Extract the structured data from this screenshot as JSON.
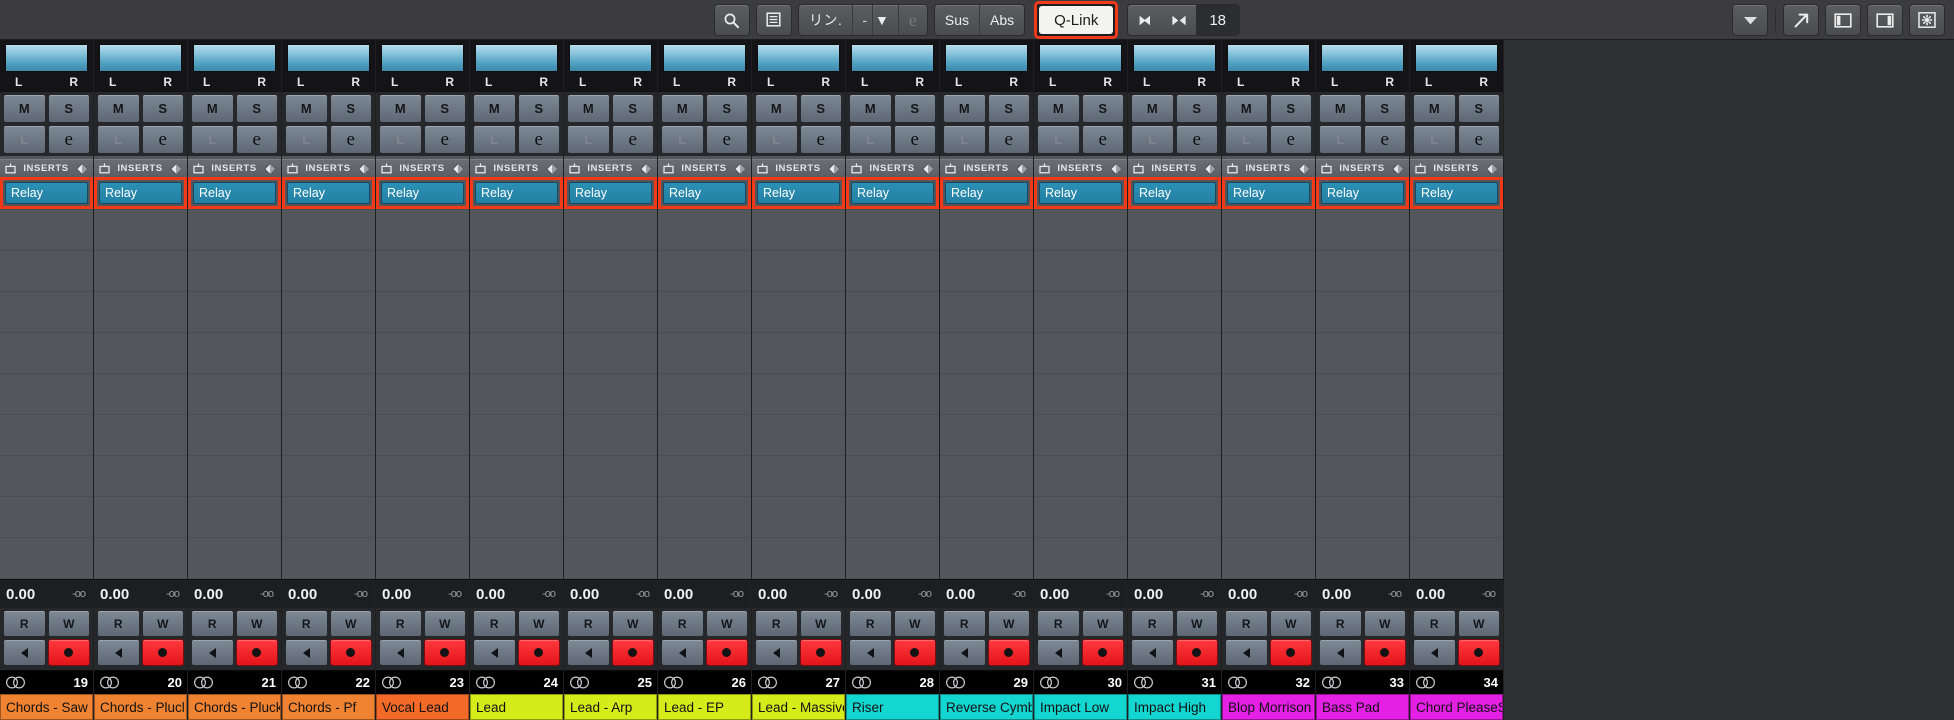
{
  "toolbar": {
    "search_icon": "magnifier-icon",
    "list_icon": "list-view-icon",
    "link_label": "リン.",
    "link_dash": "-",
    "link_caret": "▼",
    "link_disabled_glyph": "e",
    "sus_label": "Sus",
    "abs_label": "Abs",
    "qlink_label": "Q-Link",
    "nav_prev_glyph": "▶◀",
    "nav_next_glyph": "◀▶",
    "nav_value": "18",
    "right_caret": "▼",
    "expand_icon": "expand-arrow-icon",
    "panel_left_icon": "panel-left-icon",
    "panel_right_icon": "panel-right-icon",
    "settings_icon": "gear-icon"
  },
  "strip_common": {
    "pan_left": "L",
    "pan_right": "R",
    "mute_label": "M",
    "solo_label": "S",
    "input_label": "L",
    "edit_label": "e",
    "inserts_label": "INSERTS",
    "insert_plugin": "Relay",
    "gain_value": "0.00",
    "gain_peak": "-oo",
    "read_label": "R",
    "write_label": "W",
    "stereo_icon": "stereo-circles-icon",
    "power_icon": "insert-power-icon",
    "bypass_icon": "insert-bypass-icon",
    "input_arrow_icon": "play-left-icon",
    "record_dot_icon": "record-dot-icon"
  },
  "tracks": [
    {
      "number": "19",
      "name": "Chords - Saw",
      "color": "#f08331"
    },
    {
      "number": "20",
      "name": "Chords - Plucl",
      "color": "#f08331"
    },
    {
      "number": "21",
      "name": "Chords - Pluck",
      "color": "#f08331"
    },
    {
      "number": "22",
      "name": "Chords - Pf",
      "color": "#f08331"
    },
    {
      "number": "23",
      "name": "Vocal Lead",
      "color": "#f36a28"
    },
    {
      "number": "24",
      "name": "Lead",
      "color": "#d5ec1a"
    },
    {
      "number": "25",
      "name": "Lead - Arp",
      "color": "#d5ec1a"
    },
    {
      "number": "26",
      "name": "Lead - EP",
      "color": "#d5ec1a"
    },
    {
      "number": "27",
      "name": "Lead - Massive",
      "color": "#d5ec1a"
    },
    {
      "number": "28",
      "name": "Riser",
      "color": "#14d6d0"
    },
    {
      "number": "29",
      "name": "Reverse Cymba",
      "color": "#14d6d0"
    },
    {
      "number": "30",
      "name": "Impact Low",
      "color": "#14d6d0"
    },
    {
      "number": "31",
      "name": "Impact High",
      "color": "#14d6d0"
    },
    {
      "number": "32",
      "name": "Blop Morrison",
      "color": "#e520e5"
    },
    {
      "number": "33",
      "name": "Bass Pad",
      "color": "#e520e5"
    },
    {
      "number": "34",
      "name": "Chord PleaseSt",
      "color": "#e520e5"
    }
  ],
  "colors": {
    "selection": "#f23a18",
    "insert_slot": "#2480a4",
    "record": "#e31419"
  }
}
